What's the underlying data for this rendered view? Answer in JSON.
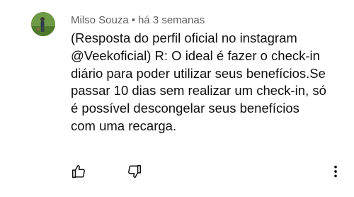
{
  "comment": {
    "author": "Milso Souza",
    "separator": "•",
    "time": "há 3 semanas",
    "lines": [
      "(Resposta do perfil oficial no instagram",
      "@Veekoficial) R: O ideal é fazer o check-in",
      "diário para poder utilizar seus benefícios.Se",
      "passar 10 dias sem realizar um check-in, só",
      "é possível descongelar seus benefícios",
      "com uma recarga."
    ]
  },
  "icons": {
    "like": "thumbs-up-icon",
    "dislike": "thumbs-down-icon",
    "more": "more-vertical-icon"
  },
  "colors": {
    "text": "#0f0f0f",
    "meta": "#606060",
    "icon": "#0f0f0f"
  }
}
